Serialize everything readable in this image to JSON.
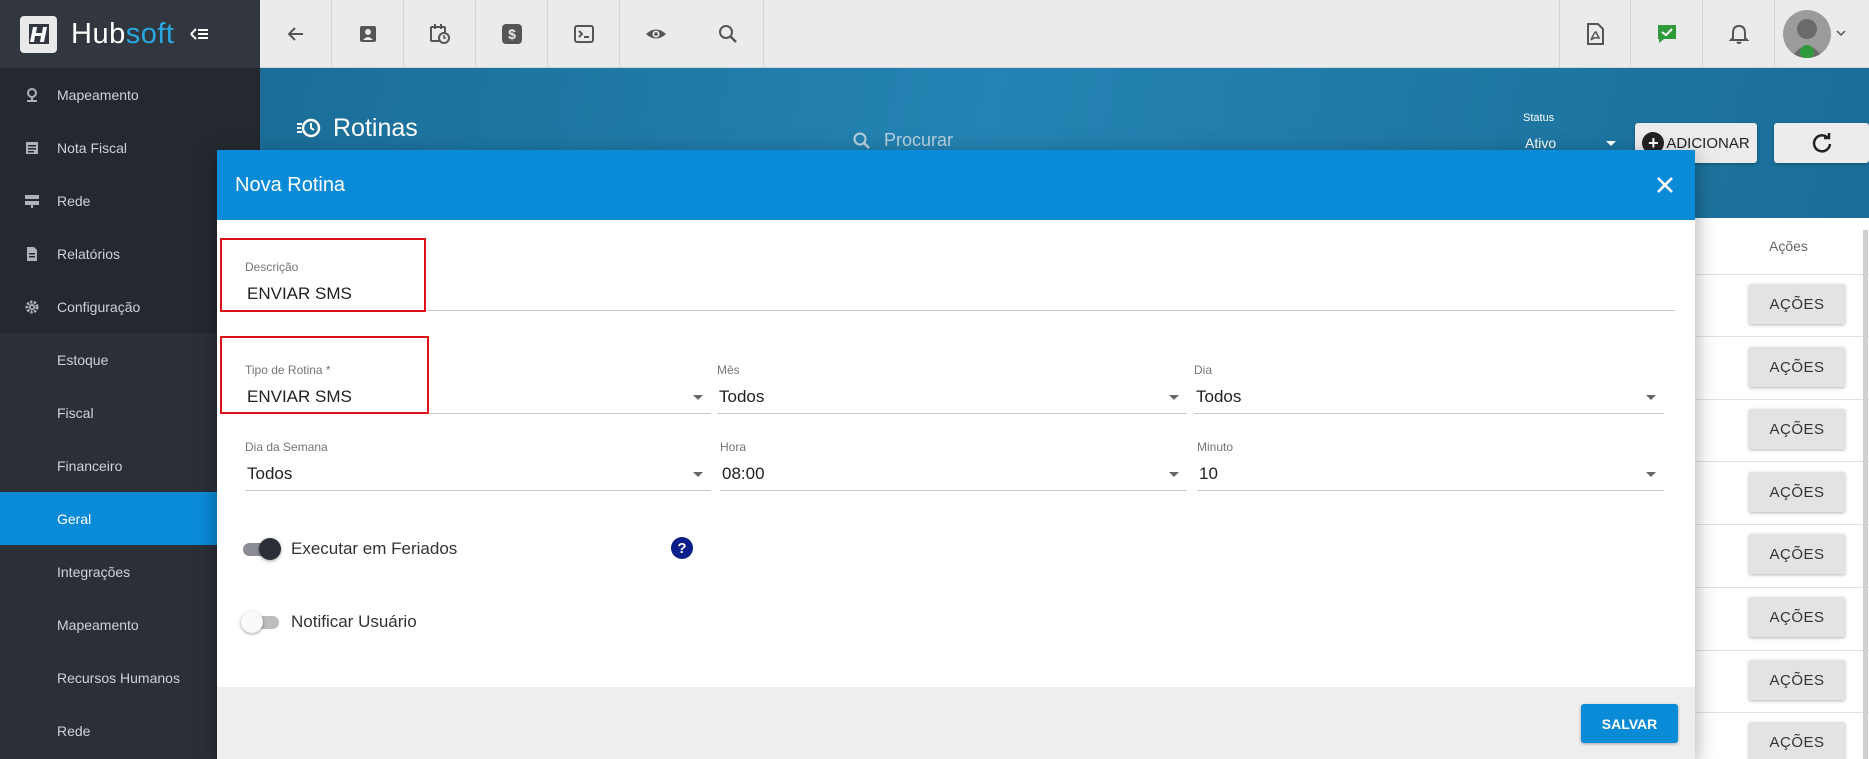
{
  "app": {
    "brand_part1": "Hub",
    "brand_part2": "soft",
    "colors": {
      "accent": "#0a8bd8",
      "sidebar": "#2b2f37",
      "header": "#1f7aa8",
      "brand": "#29a8e0"
    }
  },
  "sidebar": {
    "items": [
      {
        "label": "Mapeamento",
        "icon": "map-pin-icon"
      },
      {
        "label": "Nota Fiscal",
        "icon": "receipt-icon"
      },
      {
        "label": "Rede",
        "icon": "server-icon"
      },
      {
        "label": "Relatórios",
        "icon": "document-icon"
      },
      {
        "label": "Configuração",
        "icon": "gear-icon"
      },
      {
        "label": "Estoque"
      },
      {
        "label": "Fiscal"
      },
      {
        "label": "Financeiro"
      },
      {
        "label": "Geral",
        "active": true
      },
      {
        "label": "Integrações"
      },
      {
        "label": "Mapeamento"
      },
      {
        "label": "Recursos Humanos"
      },
      {
        "label": "Rede"
      }
    ]
  },
  "topbar": {
    "icons": [
      "back-arrow-icon",
      "contact-card-icon",
      "calendar-clock-icon",
      "dollar-icon",
      "terminal-icon",
      "eye-icon",
      "search-icon",
      "pdf-icon",
      "chat-check-icon",
      "bell-icon",
      "avatar"
    ]
  },
  "header": {
    "title": "Rotinas",
    "search_placeholder": "Procurar",
    "status_label": "Status",
    "status_value": "Ativo",
    "add_label": "ADICIONAR"
  },
  "table": {
    "actions_header": "Ações",
    "action_button_label": "AÇÕES"
  },
  "modal": {
    "title": "Nova Rotina",
    "fields": {
      "descricao": {
        "label": "Descrição",
        "value": "ENVIAR SMS"
      },
      "tipo": {
        "label": "Tipo de Rotina *",
        "value": "ENVIAR SMS"
      },
      "mes": {
        "label": "Mês",
        "value": "Todos"
      },
      "dia": {
        "label": "Dia",
        "value": "Todos"
      },
      "dia_semana": {
        "label": "Dia da Semana",
        "value": "Todos"
      },
      "hora": {
        "label": "Hora",
        "value": "08:00"
      },
      "minuto": {
        "label": "Minuto",
        "value": "10"
      }
    },
    "toggles": {
      "feriados": {
        "label": "Executar em Feriados",
        "checked": true
      },
      "notificar": {
        "label": "Notificar Usuário",
        "checked": false
      }
    },
    "help_glyph": "?",
    "save_label": "SALVAR"
  }
}
